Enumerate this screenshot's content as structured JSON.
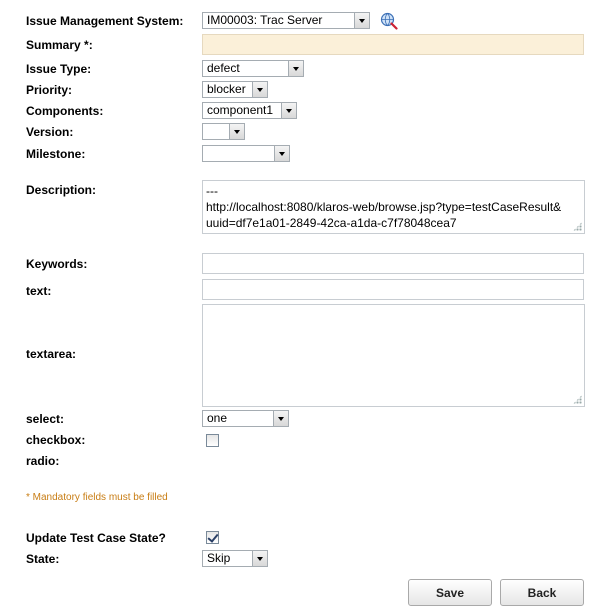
{
  "form": {
    "ims": {
      "label": "Issue Management System:",
      "value": "IM00003: Trac Server"
    },
    "summary": {
      "label": "Summary *:",
      "value": ""
    },
    "issue_type": {
      "label": "Issue Type:",
      "value": "defect"
    },
    "priority": {
      "label": "Priority:",
      "value": "blocker"
    },
    "components": {
      "label": "Components:",
      "value": "component1"
    },
    "version": {
      "label": "Version:",
      "value": ""
    },
    "milestone": {
      "label": "Milestone:",
      "value": ""
    },
    "description": {
      "label": "Description:",
      "line1": "---",
      "line2": "http://localhost:8080/klaros-web/browse.jsp?type=testCaseResult&",
      "line3": "uuid=df7e1a01-2849-42ca-a1da-c7f78048cea7"
    },
    "keywords": {
      "label": "Keywords:",
      "value": ""
    },
    "text": {
      "label": "text:",
      "value": ""
    },
    "textarea": {
      "label": "textarea:",
      "value": ""
    },
    "select": {
      "label": "select:",
      "value": "one"
    },
    "checkbox": {
      "label": "checkbox:",
      "checked": false
    },
    "radio": {
      "label": "radio:"
    },
    "mandatory_note": "* Mandatory fields must be filled",
    "update_state": {
      "label": "Update Test Case State?",
      "checked": true
    },
    "state": {
      "label": "State:",
      "value": "Skip"
    }
  },
  "buttons": {
    "save": "Save",
    "back": "Back"
  },
  "colors": {
    "summary_bg": "#fbf0d9",
    "note": "#c87d14"
  },
  "icons": {
    "lookup": "search-globe-icon"
  }
}
